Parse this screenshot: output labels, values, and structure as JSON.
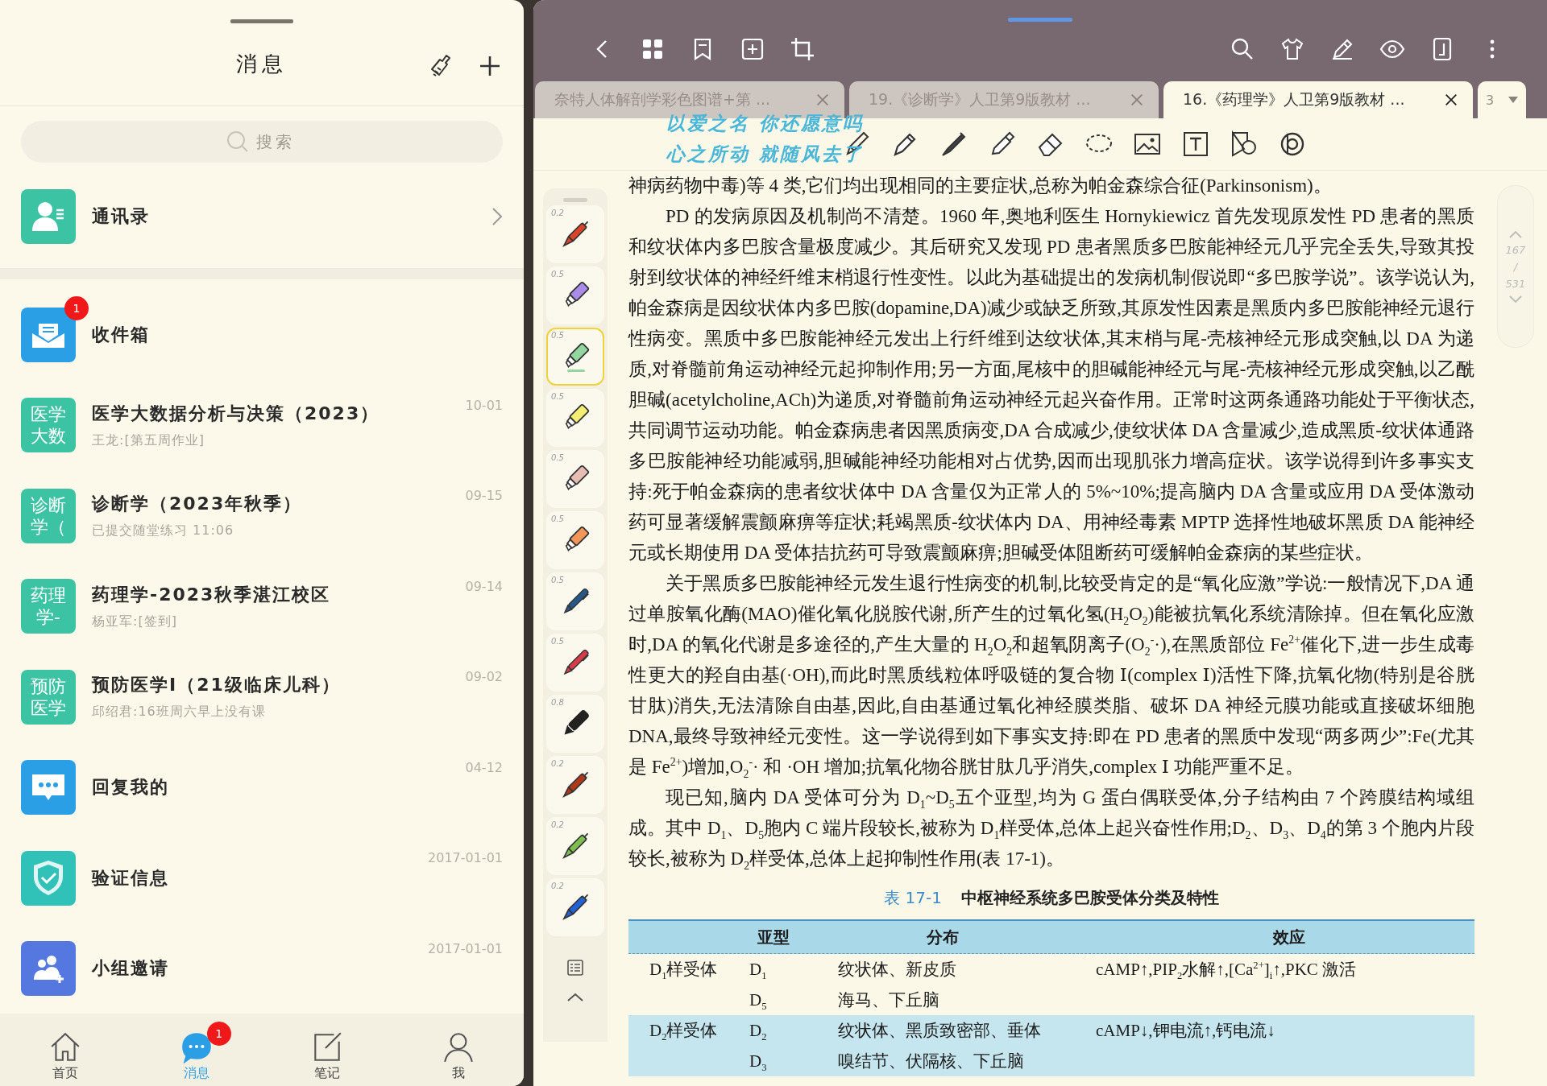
{
  "messages_panel": {
    "title": "消息",
    "search": {
      "placeholder": "搜索"
    },
    "contacts": {
      "label": "通讯录"
    },
    "conversations": [
      {
        "kind": "inbox",
        "color": "#2b9fe6",
        "title": "收件箱",
        "badge": "1"
      },
      {
        "kind": "text",
        "icon_text": "医学大数",
        "color": "#3cc3a3",
        "title": "医学大数据分析与决策（2023）",
        "subtitle": "王龙:[第五周作业]",
        "date": "10-01"
      },
      {
        "kind": "text",
        "icon_text": "诊断学（",
        "color": "#3cc3a3",
        "title": "诊断学（2023年秋季）",
        "subtitle": "已提交随堂练习 11:06",
        "date": "09-15"
      },
      {
        "kind": "text",
        "icon_text": "药理学-",
        "color": "#3cc3a3",
        "title": "药理学-2023秋季湛江校区",
        "subtitle": "杨亚军:[签到]",
        "date": "09-14"
      },
      {
        "kind": "text",
        "icon_text": "预防医学",
        "color": "#3cc3a3",
        "title": "预防医学I（21级临床儿科）",
        "subtitle": "邱绍君:16班周六早上没有课",
        "date": "09-02"
      },
      {
        "kind": "reply",
        "color": "#2b9fe6",
        "title": "回复我的",
        "date": "04-12"
      },
      {
        "kind": "verify",
        "color": "#30c2b8",
        "title": "验证信息",
        "date": "2017-01-01"
      },
      {
        "kind": "group",
        "color": "#5577e0",
        "title": "小组邀请",
        "date": "2017-01-01"
      }
    ],
    "bottom_nav": [
      {
        "label": "首页",
        "kind": "home",
        "selected": false
      },
      {
        "label": "消息",
        "kind": "chat",
        "selected": true,
        "badge": "1"
      },
      {
        "label": "笔记",
        "kind": "note",
        "selected": false
      },
      {
        "label": "我",
        "kind": "person",
        "selected": false
      }
    ]
  },
  "reader": {
    "tabs": [
      {
        "label": "奈特人体解剖学彩色图谱+第 ...",
        "selected": false
      },
      {
        "label": "19.《诊断学》人卫第9版教材 ...",
        "selected": false
      },
      {
        "label": "16.《药理学》人卫第9版教材 ...",
        "selected": true
      }
    ],
    "more_tabs": "3",
    "floating_lyrics": [
      "以爱之名 你还愿意吗",
      "心之所动 就随风去了"
    ],
    "pens": [
      {
        "kind": "brush",
        "size": "0.2",
        "color": "#d9442a",
        "selected": false
      },
      {
        "kind": "highlighter",
        "size": "0.5",
        "color": "#a98be8",
        "selected": false
      },
      {
        "kind": "highlighter",
        "size": "0.5",
        "color": "#92d6a0",
        "selected": true
      },
      {
        "kind": "highlighter",
        "size": "0.5",
        "color": "#f3ef72",
        "selected": false
      },
      {
        "kind": "highlighter",
        "size": "0.5",
        "color": "#e7bcb2",
        "selected": false
      },
      {
        "kind": "highlighter",
        "size": "0.5",
        "color": "#f2965a",
        "selected": false
      },
      {
        "kind": "pen",
        "size": "0.5",
        "color": "#28578a",
        "selected": false
      },
      {
        "kind": "pen",
        "size": "0.5",
        "color": "#d63d48",
        "selected": false
      },
      {
        "kind": "marker",
        "size": "0.8",
        "color": "#222222",
        "selected": false
      },
      {
        "kind": "brush",
        "size": "0.2",
        "color": "#b0381a",
        "selected": false
      },
      {
        "kind": "brush",
        "size": "0.2",
        "color": "#7cbf4e",
        "selected": false
      },
      {
        "kind": "brush",
        "size": "0.2",
        "color": "#2262d2",
        "selected": false
      }
    ],
    "page": {
      "current": "167",
      "separator": "/",
      "total": "531"
    },
    "document": {
      "cut_line": "神病药物中毒)等 4 类,它们均出现相同的主要症状,总称为帕金森综合征(Parkinsonism)。",
      "paragraphs": [
        "PD 的发病原因及机制尚不清楚。1960 年,奥地利医生 Hornykiewicz 首先发现原发性 PD 患者的黑质和纹状体内多巴胺含量极度减少。其后研究又发现 PD 患者黑质多巴胺能神经元几乎完全丢失,导致其投射到纹状体的神经纤维末梢退行性变性。以此为基础提出的发病机制假说即“多巴胺学说”。该学说认为,帕金森病是因纹状体内多巴胺(dopamine,DA)减少或缺乏所致,其原发性因素是黑质内多巴胺能神经元退行性病变。黑质中多巴胺能神经元发出上行纤维到达纹状体,其末梢与尾-壳核神经元形成突触,以 DA 为递质,对脊髓前角运动神经元起抑制作用;另一方面,尾核中的胆碱能神经元与尾-壳核神经元形成突触,以乙酰胆碱(acetylcholine,ACh)为递质,对脊髓前角运动神经元起兴奋作用。正常时这两条通路功能处于平衡状态,共同调节运动功能。帕金森病患者因黑质病变,DA 合成减少,使纹状体 DA 含量减少,造成黑质-纹状体通路多巴胺能神经功能减弱,胆碱能神经功能相对占优势,因而出现肌张力增高症状。该学说得到许多事实支持:死于帕金森病的患者纹状体中 DA 含量仅为正常人的 5%~10%;提高脑内 DA 含量或应用 DA 受体激动药可显著缓解震颤麻痹等症状;耗竭黑质-纹状体内 DA、用神经毒素 MPTP 选择性地破坏黑质 DA 能神经元或长期使用 DA 受体拮抗药可导致震颤麻痹;胆碱受体阻断药可缓解帕金森病的某些症状。",
        "关于黑质多巴胺能神经元发生退行性病变的机制,比较受肯定的是“氧化应激”学说:一般情况下,DA 通过单胺氧化酶(MAO)催化氧化脱胺代谢,所产生的过氧化氢(H$_{2}$O$_{2}$)能被抗氧化系统清除掉。但在氧化应激时,DA 的氧化代谢是多途径的,产生大量的 H$_{2}$O$_{2}$和超氧阴离子(O$_{2}$$^{-}$·),在黑质部位 Fe$^{2+}$催化下,进一步生成毒性更大的羟自由基(·OH),而此时黑质线粒体呼吸链的复合物 Ⅰ(complex Ⅰ)活性下降,抗氧化物(特别是谷胱甘肽)消失,无法清除自由基,因此,自由基通过氧化神经膜类脂、破坏 DA 神经元膜功能或直接破坏细胞 DNA,最终导致神经元变性。这一学说得到如下事实支持:即在 PD 患者的黑质中发现“两多两少”:Fe(尤其是 Fe$^{2+}$)增加,O$_{2}$$^{-}$· 和 ·OH 增加;抗氧化物谷胱甘肽几乎消失,complex Ⅰ 功能严重不足。",
        "现已知,脑内 DA 受体可分为 D$_{1}$~D$_{5}$五个亚型,均为 G 蛋白偶联受体,分子结构由 7 个跨膜结构域组成。其中 D$_{1}$、D$_{5}$胞内 C 端片段较长,被称为 D$_{1}$样受体,总体上起兴奋性作用;D$_{2}$、D$_{3}$、D$_{4}$的第 3 个胞内片段较长,被称为 D$_{2}$样受体,总体上起抑制性作用(表 17-1)。"
      ],
      "table": {
        "caption_number": "表 17-1",
        "caption_title": "中枢神经系统多巴胺受体分类及特性",
        "columns": [
          "亚型",
          "分布",
          "效应"
        ],
        "rows": [
          {
            "group": "D$_{1}$样受体",
            "subtype": "D$_{1}$",
            "distribution": "纹状体、新皮质",
            "effect": "cAMP↑,PIP$_{2}$水解↑,[Ca$^{2+}$]$_{i}$↑,PKC 激活",
            "shaded": false
          },
          {
            "subtype": "D$_{5}$",
            "distribution": "海马、下丘脑",
            "shaded": false
          },
          {
            "group": "D$_{2}$样受体",
            "subtype": "D$_{2}$",
            "distribution": "纹状体、黑质致密部、垂体",
            "effect": "cAMP↓,钾电流↑,钙电流↓",
            "shaded": true
          },
          {
            "subtype": "D$_{3}$",
            "distribution": "嗅结节、伏隔核、下丘脑",
            "shaded": true
          }
        ]
      }
    }
  }
}
